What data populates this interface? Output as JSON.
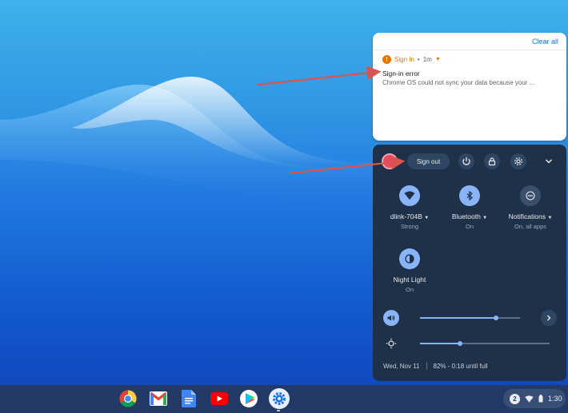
{
  "notification_center": {
    "clear_all_label": "Clear all",
    "notification": {
      "app_name": "Sign In",
      "separator": "•",
      "time": "1m",
      "title": "Sign-in error",
      "body": "Chrome OS could not sync your data because your ..."
    }
  },
  "quick_settings": {
    "sign_out_label": "Sign out",
    "tiles": [
      {
        "label": "dlink-704B",
        "sub": "Strong",
        "icon": "wifi-icon",
        "state": "on"
      },
      {
        "label": "Bluetooth",
        "sub": "On",
        "icon": "bluetooth-icon",
        "state": "on"
      },
      {
        "label": "Notifications",
        "sub": "On, all apps",
        "icon": "do-not-disturb-icon",
        "state": "off"
      },
      {
        "label": "Night Light",
        "sub": "On",
        "icon": "night-light-icon",
        "state": "on"
      }
    ],
    "volume_level": 0.76,
    "brightness_level": 0.31,
    "date": "Wed, Nov 11",
    "battery": "82% - 0:18 until full"
  },
  "shelf": {
    "apps": [
      "chrome-icon",
      "gmail-icon",
      "docs-icon",
      "youtube-icon",
      "play-store-icon",
      "settings-icon"
    ],
    "notification_count": "2",
    "time": "1:30"
  },
  "colors": {
    "accent": "#8ab4f8",
    "warning": "#e37400",
    "link": "#1a73e8",
    "annotation_arrow": "#d9534f"
  }
}
